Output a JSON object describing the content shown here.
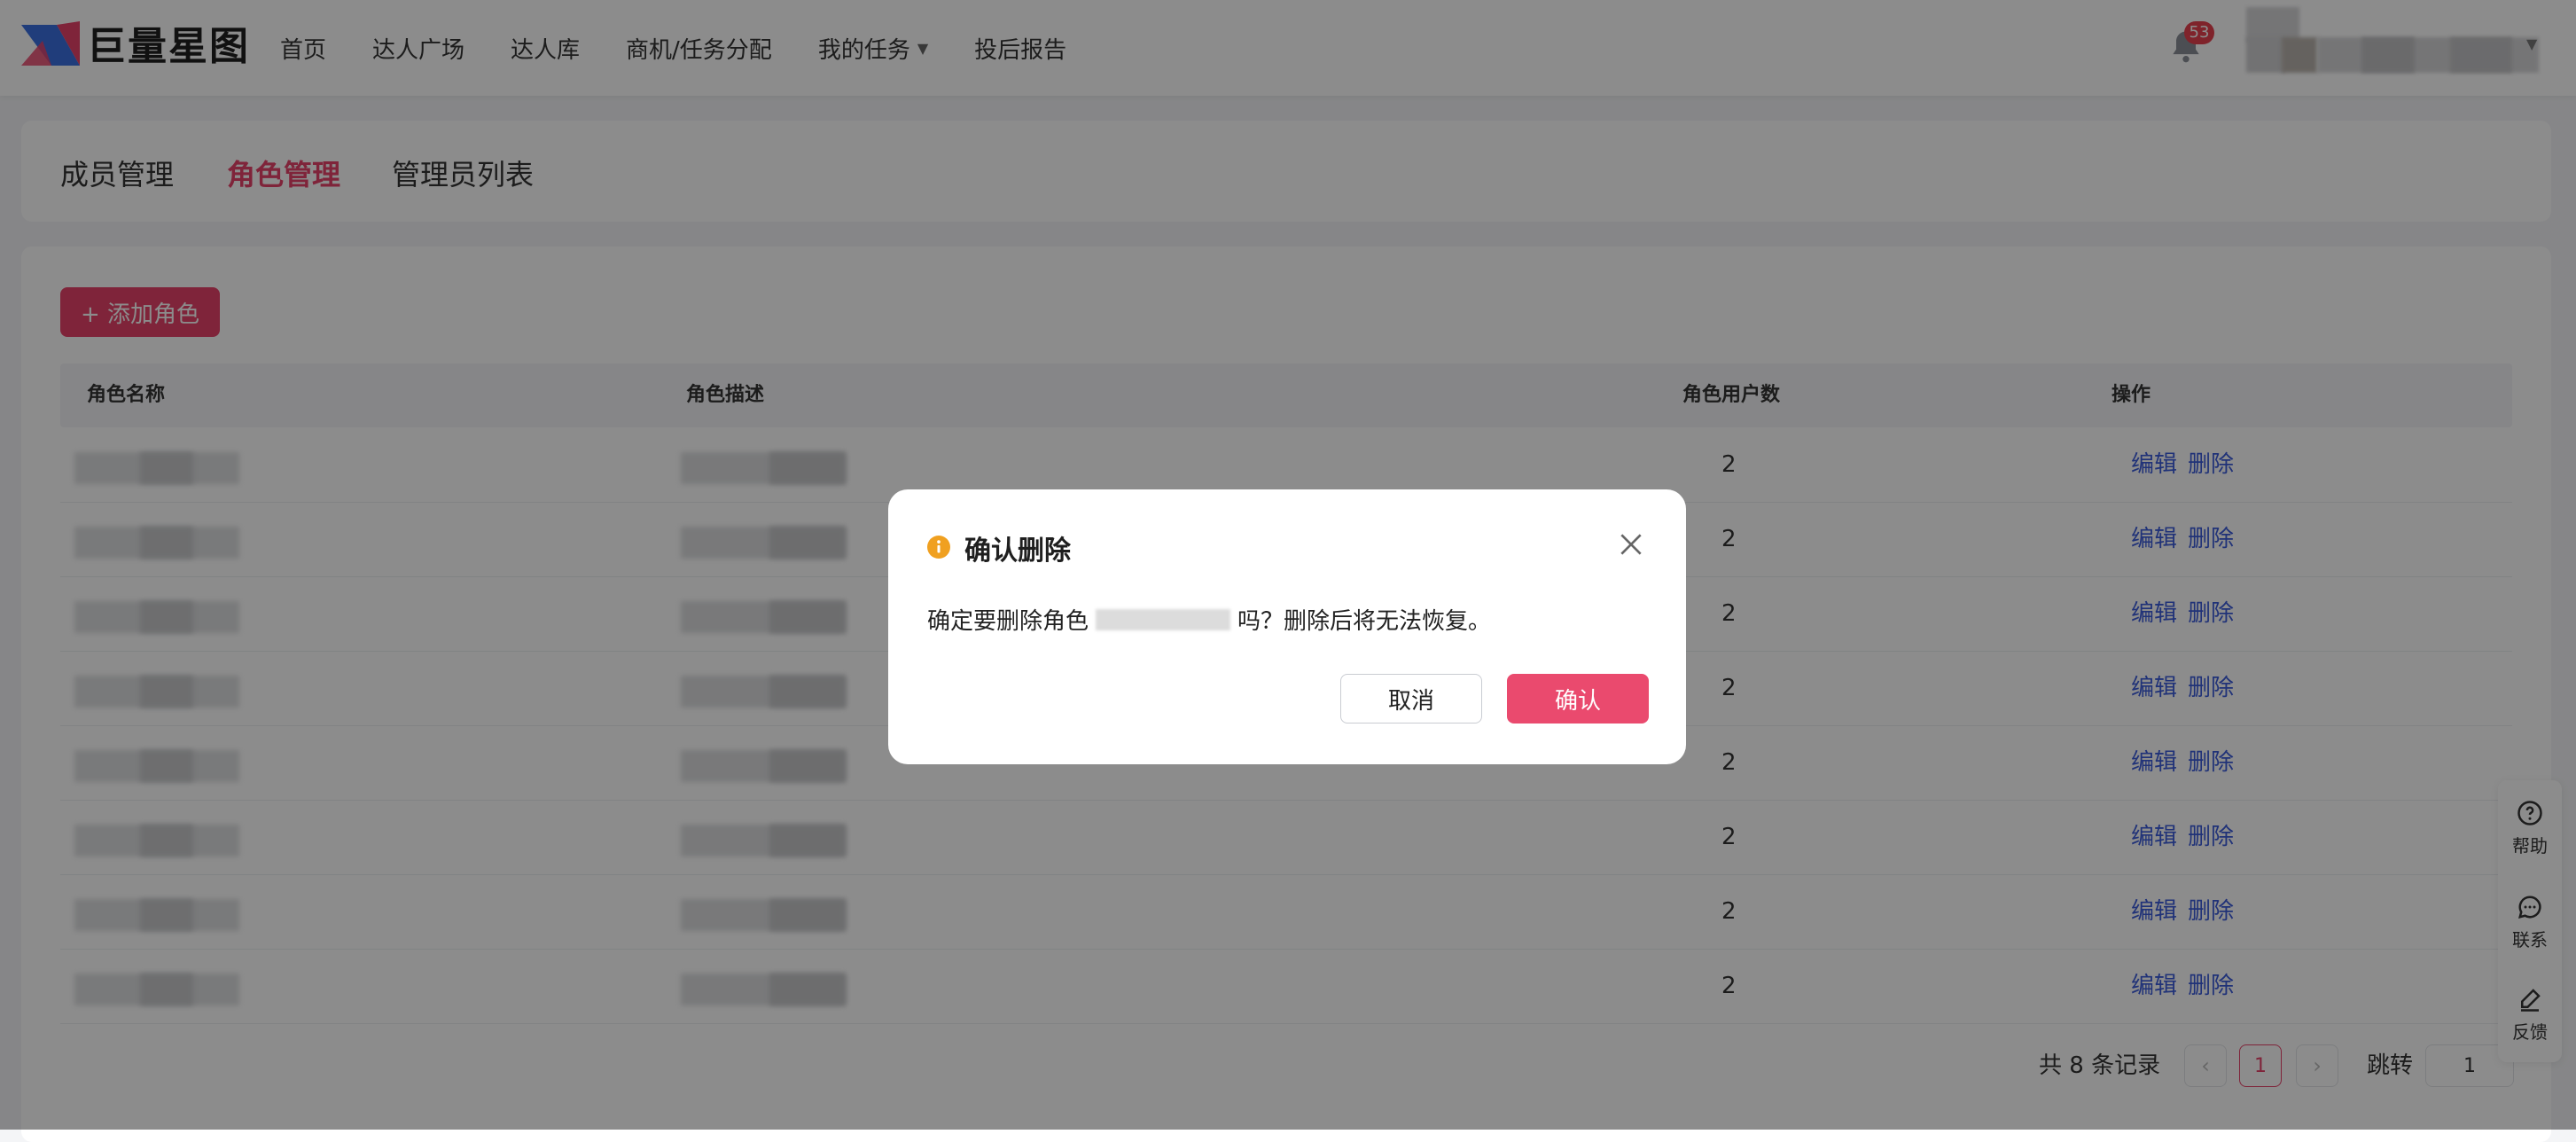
{
  "brand": {
    "name": "巨量星图",
    "accent": "#e8436a"
  },
  "nav": {
    "items": [
      {
        "label": "首页"
      },
      {
        "label": "达人广场"
      },
      {
        "label": "达人库"
      },
      {
        "label": "商机/任务分配"
      },
      {
        "label": "我的任务"
      },
      {
        "label": "投后报告"
      }
    ],
    "notification_count": "53"
  },
  "tabs": [
    {
      "label": "成员管理",
      "active": false
    },
    {
      "label": "角色管理",
      "active": true
    },
    {
      "label": "管理员列表",
      "active": false
    }
  ],
  "toolbar": {
    "add_role_label": "+ 添加角色"
  },
  "table": {
    "headers": {
      "name": "角色名称",
      "desc": "角色描述",
      "count": "角色用户数",
      "actions": "操作"
    },
    "rows": [
      {
        "count": "2",
        "edit": "编辑",
        "delete": "删除"
      },
      {
        "count": "2",
        "edit": "编辑",
        "delete": "删除"
      },
      {
        "count": "2",
        "edit": "编辑",
        "delete": "删除"
      },
      {
        "count": "2",
        "edit": "编辑",
        "delete": "删除"
      },
      {
        "count": "2",
        "edit": "编辑",
        "delete": "删除"
      },
      {
        "count": "2",
        "edit": "编辑",
        "delete": "删除"
      },
      {
        "count": "2",
        "edit": "编辑",
        "delete": "删除"
      },
      {
        "count": "2",
        "edit": "编辑",
        "delete": "删除"
      }
    ]
  },
  "pagination": {
    "total_text": "共 8 条记录",
    "prev": "‹",
    "current_page": "1",
    "next": "›",
    "jump_label": "跳转",
    "jump_value": "1"
  },
  "float_bar": {
    "help": "帮助",
    "contact": "联系",
    "feedback": "反馈"
  },
  "dialog": {
    "title": "确认删除",
    "message_prefix": "确定要删除角色",
    "message_suffix": "吗？删除后将无法恢复。",
    "cancel_label": "取消",
    "confirm_label": "确认",
    "warning_color": "#f0a020"
  }
}
